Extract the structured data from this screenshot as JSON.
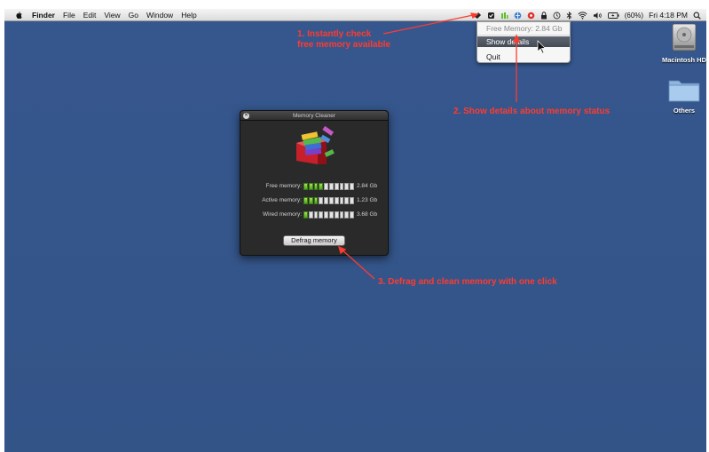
{
  "menubar": {
    "app": "Finder",
    "menus": [
      "File",
      "Edit",
      "View",
      "Go",
      "Window",
      "Help"
    ],
    "battery": "(60%)",
    "clock": "Fri 4:18 PM",
    "icons": [
      "apple-icon",
      "memory-cleaner-icon",
      "dropbox-icon",
      "usage-icon",
      "vpn-icon",
      "record-icon",
      "lock-icon",
      "time-machine-icon",
      "bluetooth-icon",
      "wifi-icon",
      "volume-icon",
      "battery-icon",
      "spotlight-icon"
    ]
  },
  "dropdown": {
    "free_memory": "Free Memory: 2.84 Gb",
    "show_details": "Show details",
    "quit": "Quit"
  },
  "desktop": {
    "hd_label": "Macintosh HD",
    "folder_label": "Others"
  },
  "annotations": {
    "a1_line1": "1. Instantly check",
    "a1_line2": "free memory available",
    "a2": "2. Show details about memory status",
    "a3": "3. Defrag and clean memory with one click"
  },
  "window": {
    "title": "Memory Cleaner",
    "rows": [
      {
        "label": "Free memory:",
        "value": "2.84 Gb",
        "filled": 4,
        "total": 10
      },
      {
        "label": "Active memory:",
        "value": "1.23 Gb",
        "filled": 3,
        "total": 10
      },
      {
        "label": "Wired memory:",
        "value": "3.68 Gb",
        "filled": 1,
        "total": 10
      }
    ],
    "defrag_label": "Defrag memory"
  },
  "colors": {
    "desktop": "#35568c",
    "annotation": "#ff3b2f",
    "bar_fill": "#4caa1e"
  }
}
